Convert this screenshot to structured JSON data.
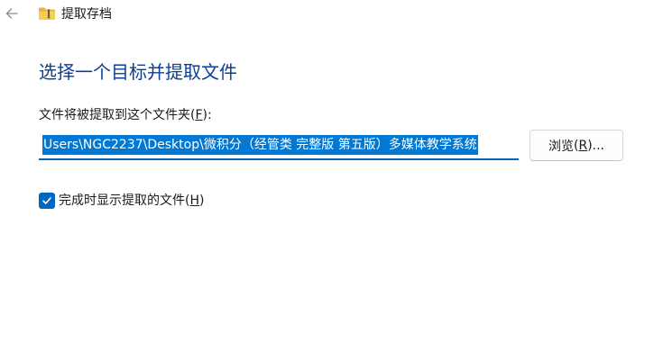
{
  "window": {
    "title": "提取存档"
  },
  "page": {
    "heading": "选择一个目标并提取文件"
  },
  "destination": {
    "label": "文件将被提取到这个文件夹",
    "label_accel_open": "(",
    "label_accel_key": "F",
    "label_accel_close": "):",
    "path_value": "Users\\NGC2237\\Desktop\\微积分（经管类 完整版 第五版）多媒体教学系统",
    "browse_label": "浏览",
    "browse_accel_open": "(",
    "browse_accel_key": "R",
    "browse_accel_close": ")..."
  },
  "options": {
    "show_files_label": "完成时显示提取的文件",
    "show_files_accel_open": "(",
    "show_files_accel_key": "H",
    "show_files_accel_close": ")",
    "show_files_checked": true
  },
  "colors": {
    "accent": "#0067c0",
    "heading": "#0a3f94",
    "selection": "#0078d4"
  },
  "icons": {
    "back": "arrow-left-icon",
    "folder": "zip-folder-icon",
    "check": "checkmark-icon"
  }
}
